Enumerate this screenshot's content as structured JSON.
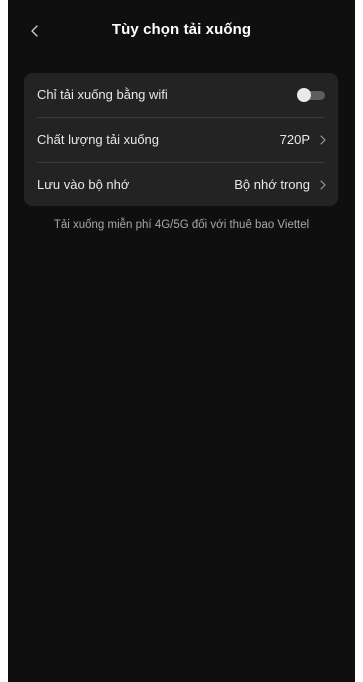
{
  "header": {
    "title": "Tùy chọn tải xuống",
    "back_icon": "chevron-left-icon"
  },
  "settings": {
    "wifi_only": {
      "label": "Chỉ tải xuống bằng wifi",
      "enabled": false
    },
    "quality": {
      "label": "Chất lượng tải xuống",
      "value": "720P"
    },
    "storage": {
      "label": "Lưu vào bộ nhớ",
      "value": "Bộ nhớ trong"
    }
  },
  "note": "Tải xuống miễn phí 4G/5G đối với thuê bao Viettel",
  "colors": {
    "background": "#0f0f0f",
    "card": "#232323",
    "text": "#e8e8e8",
    "muted": "#a8a8a8"
  }
}
